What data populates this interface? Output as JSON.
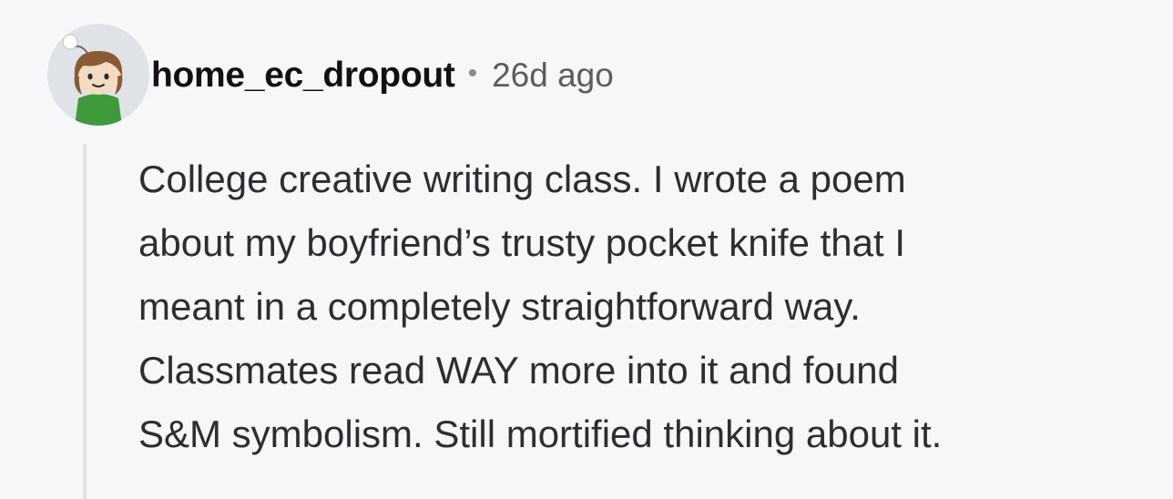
{
  "comment": {
    "author": "home_ec_dropout",
    "separator": "•",
    "age": "26d ago",
    "avatar_icon": "snoo-avatar-icon",
    "body_lines": [
      "College creative writing class. I wrote a poem",
      "about my boyfriend’s trusty pocket knife that I",
      "meant in a completely straightforward way.",
      "Classmates read WAY more into it and found",
      "S&M symbolism. Still mortified thinking about it."
    ]
  },
  "colors": {
    "background": "#f6f7f8",
    "thread_line": "#dde2e7",
    "username": "#111111",
    "timestamp": "#5a5d61",
    "body_text": "#2c2e31"
  }
}
